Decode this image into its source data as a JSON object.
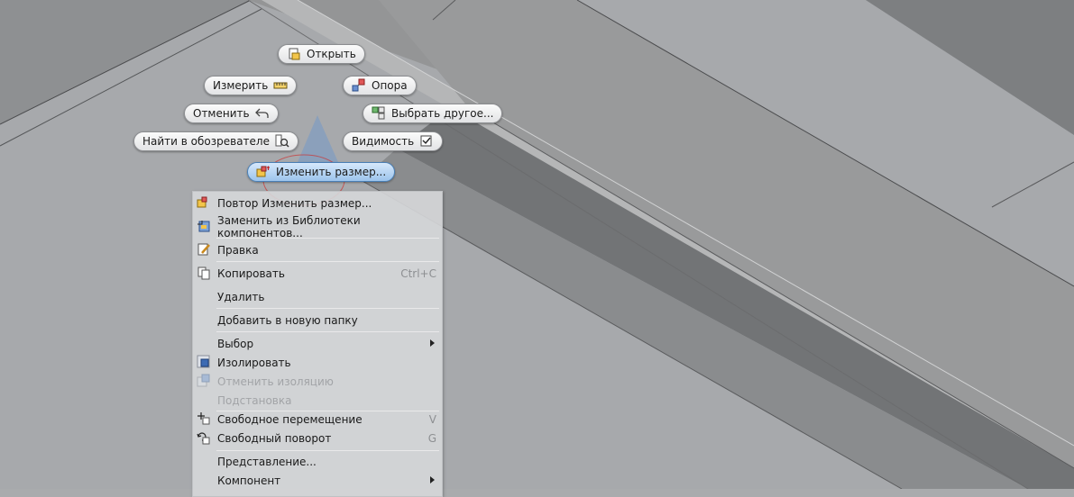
{
  "marking_menu": {
    "open": "Открыть",
    "measure": "Измерить",
    "support": "Опора",
    "undo": "Отменить",
    "select_other": "Выбрать другое...",
    "find_in_browser": "Найти в обозревателе",
    "visibility": "Видимость",
    "resize": "Изменить размер..."
  },
  "context_menu": {
    "items": [
      {
        "label": "Повтор Изменить размер...",
        "icon": "resize-icon"
      },
      {
        "label": "Заменить из Библиотеки компонентов...",
        "icon": "library-replace-icon"
      },
      {
        "label": "Правка",
        "icon": "edit-icon"
      },
      {
        "label": "Копировать",
        "shortcut": "Ctrl+C",
        "icon": "copy-icon"
      },
      {
        "label": "Удалить"
      },
      {
        "label": "Добавить в новую папку"
      },
      {
        "label": "Выбор",
        "submenu": true
      },
      {
        "label": "Изолировать",
        "icon": "isolate-icon"
      },
      {
        "label": "Отменить изоляцию",
        "disabled": true,
        "icon": "undo-isolate-icon"
      },
      {
        "label": "Подстановка",
        "disabled": true
      },
      {
        "label": "Свободное перемещение",
        "shortcut": "V",
        "icon": "free-move-icon"
      },
      {
        "label": "Свободный поворот",
        "shortcut": "G",
        "icon": "free-rotate-icon"
      },
      {
        "label": "Представление..."
      },
      {
        "label": "Компонент",
        "submenu": true
      }
    ]
  },
  "colors": {
    "viewport_bg": "#a9abad",
    "beam_top": "#9d9e9f",
    "beam_side": "#6b6d6f",
    "menu_bg": "#d6d7d9",
    "active_button": "#9cc4ec"
  }
}
